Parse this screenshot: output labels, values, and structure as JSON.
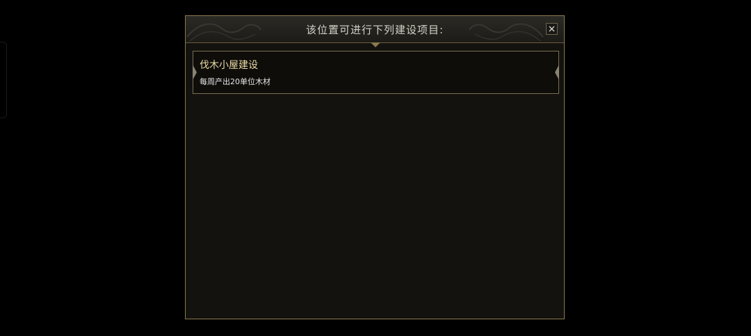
{
  "dialog": {
    "title": "该位置可进行下列建设项目:",
    "close_icon": "close-icon",
    "colors": {
      "border_gold": "#8b7a4e",
      "panel_bg": "#13120e",
      "title_text": "#d4d1c8",
      "option_title_text": "#e9d9a4"
    }
  },
  "options": [
    {
      "title": "伐木小屋建设",
      "description": "每周产出20单位木材"
    }
  ]
}
